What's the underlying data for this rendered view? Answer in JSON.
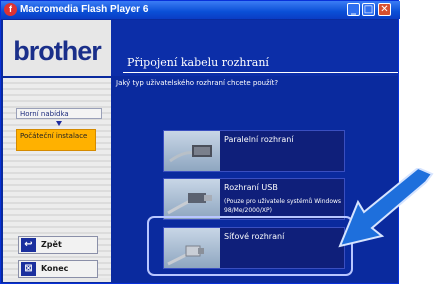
{
  "window": {
    "title": "Macromedia Flash Player 6",
    "logo_glyph": "f",
    "controls": {
      "minimize": "_",
      "maximize": "□",
      "close": "✕"
    }
  },
  "sidebar": {
    "brand": "brother",
    "nav": {
      "main_menu": "Horní nabídka",
      "start_install": "Počáteční instalace"
    },
    "back_button": {
      "icon": "arrow-back-icon",
      "glyph": "↩",
      "label": "Zpět"
    },
    "exit_button": {
      "icon": "exit-icon",
      "glyph": "⊠",
      "label": "Konec"
    }
  },
  "content": {
    "heading": "Připojení kabelu rozhraní",
    "question": "Jaký typ uživatelského rozhraní chcete použít?",
    "options": [
      {
        "label": "Paralelní rozhraní",
        "note": "",
        "icon": "parallel-cable-icon"
      },
      {
        "label": "Rozhraní USB",
        "note": "(Pouze pro uživatele systémů Windows 98/Me/2000/XP)",
        "icon": "usb-cable-icon"
      },
      {
        "label": "Síťové rozhraní",
        "note": "",
        "icon": "network-cable-icon"
      }
    ]
  },
  "colors": {
    "panel_blue": "#0a2a9e",
    "accent_orange": "#ffb100",
    "arrow_blue": "#1e6fdc"
  }
}
